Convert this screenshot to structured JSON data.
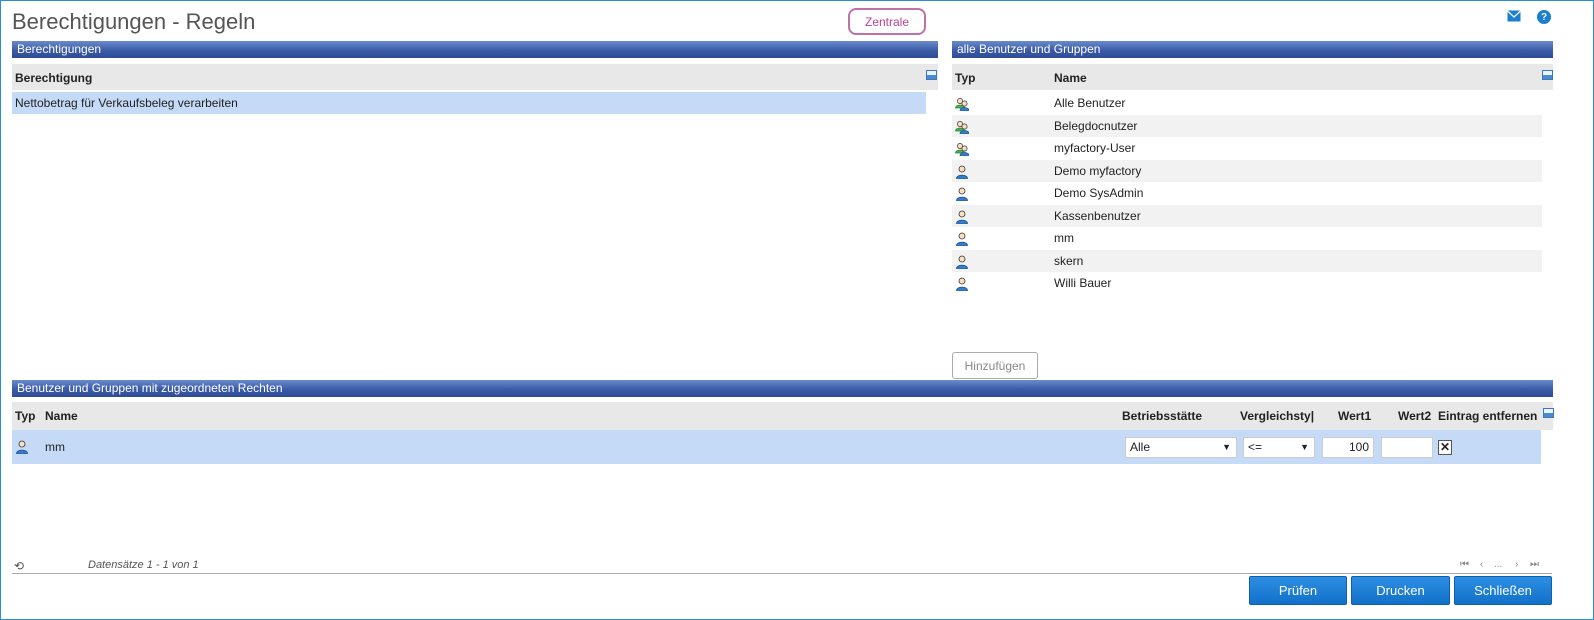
{
  "page": {
    "title": "Berechtigungen - Regeln",
    "zentrale_label": "Zentrale"
  },
  "top_icons": {
    "mail": "mail-icon",
    "help": "?"
  },
  "left_panel": {
    "header": "Berechtigungen",
    "column": "Berechtigung",
    "rows": [
      "Nettobetrag für Verkaufsbeleg verarbeiten"
    ]
  },
  "right_panel": {
    "header": "alle Benutzer und Gruppen",
    "col_typ": "Typ",
    "col_name": "Name",
    "rows": [
      {
        "type": "group",
        "name": "Alle Benutzer"
      },
      {
        "type": "group",
        "name": "Belegdocnutzer"
      },
      {
        "type": "group",
        "name": "myfactory-User"
      },
      {
        "type": "user",
        "name": "Demo myfactory"
      },
      {
        "type": "user",
        "name": "Demo SysAdmin"
      },
      {
        "type": "user",
        "name": "Kassenbenutzer"
      },
      {
        "type": "user",
        "name": "mm"
      },
      {
        "type": "user",
        "name": "skern"
      },
      {
        "type": "user",
        "name": "Willi Bauer"
      }
    ],
    "add_button": "Hinzufügen"
  },
  "bottom_panel": {
    "header": "Benutzer und Gruppen mit zugeordneten Rechten",
    "columns": {
      "typ": "Typ",
      "name": "Name",
      "betrieb": "Betriebsstätte",
      "vergleich": "Vergleichsty|",
      "wert1": "Wert1",
      "wert2": "Wert2",
      "entfernen": "Eintrag entfernen"
    },
    "rows": [
      {
        "type": "user",
        "name": "mm",
        "betrieb": "Alle",
        "vergleich": "<=",
        "wert1": "100",
        "wert2": "",
        "remove": "✕"
      }
    ]
  },
  "footer": {
    "records": "Datensätze 1 - 1 von 1",
    "pager": {
      "first": "⏮",
      "prev": "‹",
      "ellipsis": "...",
      "next": "›",
      "last": "⏭"
    },
    "refresh_icon": "⟲"
  },
  "buttons": {
    "pruefen": "Prüfen",
    "drucken": "Drucken",
    "schliessen": "Schließen"
  }
}
